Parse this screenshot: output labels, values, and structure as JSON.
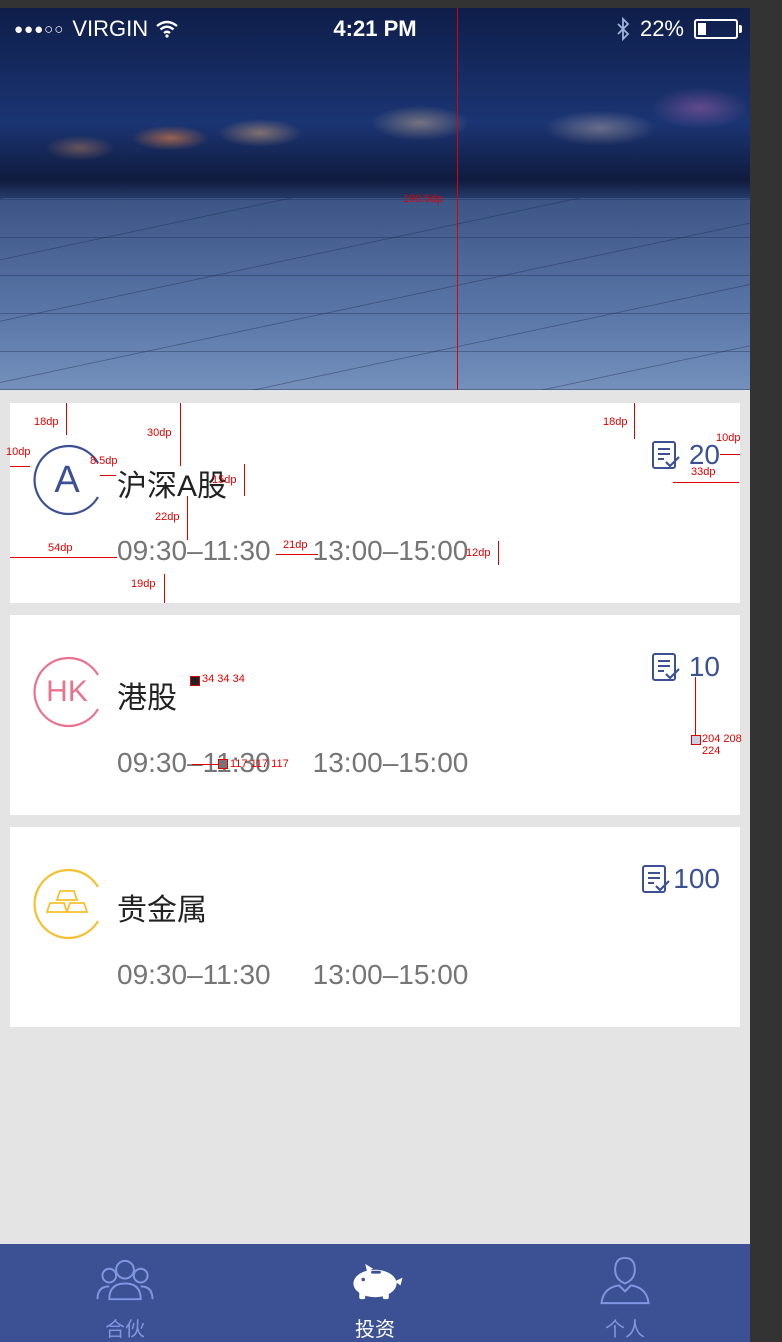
{
  "status_bar": {
    "signal": "●●●○○",
    "carrier": "VIRGIN",
    "time": "4:21 PM",
    "battery": "22%",
    "battery_level": 0.22
  },
  "cards": [
    {
      "icon": "A",
      "name": "沪深A股",
      "times": [
        "09:30–11:30",
        "13:00–15:00"
      ],
      "count": "20",
      "accent": "#3c5194"
    },
    {
      "icon": "HK",
      "name": "港股",
      "times": [
        "09:30–11:30",
        "13:00–15:00"
      ],
      "count": "10",
      "accent": "#e9728e"
    },
    {
      "icon": "gold-bars-icon",
      "name": "贵金属",
      "times": [
        "09:30–11:30",
        "13:00–15:00"
      ],
      "count": "100",
      "accent": "#f5c02f"
    }
  ],
  "annotations": {
    "hero_height": "190.5dp",
    "top_margin": "18dp",
    "logo_top": "30dp",
    "left_margin": "10dp",
    "logo_gap": "8.5dp",
    "text_size": "15dp",
    "name_gap": "22dp",
    "time_indent": "54dp",
    "time_gap": "21dp",
    "time_size": "12dp",
    "bottom_margin": "19dp",
    "badge_top": "18dp",
    "badge_right": "10dp",
    "badge_width": "33dp",
    "color_name": "34 34 34",
    "color_time": "117 117 117",
    "color_badge": "204 208 224"
  },
  "tabs": [
    {
      "label": "合伙",
      "icon": "partners-icon",
      "active": false
    },
    {
      "label": "投资",
      "icon": "piggy-bank-icon",
      "active": true
    },
    {
      "label": "个人",
      "icon": "person-icon",
      "active": false
    }
  ],
  "colors": {
    "primary": "#3c5194",
    "background": "#e4e4e4",
    "text_dark": "#222222",
    "text_gray": "#757575",
    "tab_inactive": "#7f97e0"
  }
}
